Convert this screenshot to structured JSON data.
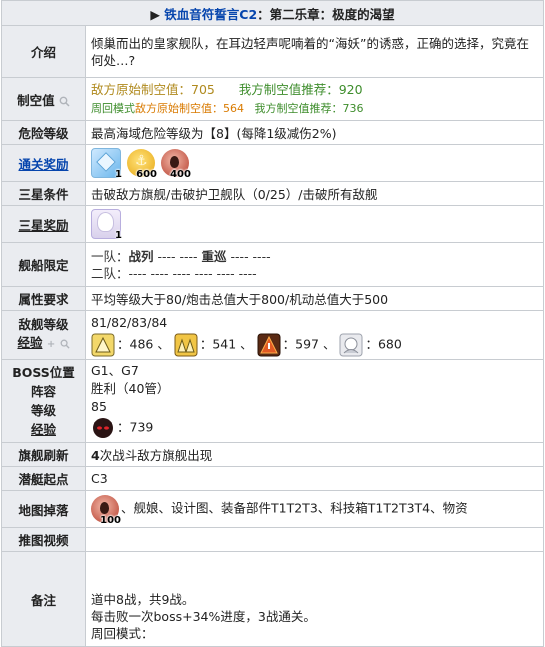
{
  "title": {
    "arrow": "▶ ",
    "link": "铁血音符誓言C2",
    "rest": "：第二乐章：极度的渴望"
  },
  "intro": {
    "label": "介绍",
    "text": "倾巢而出的皇家舰队，在耳边轻声呢喃着的“海妖”的诱惑，正确的选择，究竟在何处…?"
  },
  "air": {
    "label": "制空值",
    "line1_a": "敌方原始制空值：705",
    "line1_b": "我方制空值推荐：920",
    "line2_prefix": "周回模式",
    "line2_a": "敌方原始制空值：564",
    "line2_b": "我方制空值推荐：736"
  },
  "danger": {
    "label": "危险等级",
    "text": "最高海域危险等级为【8】(每降1级减伤2%)"
  },
  "clear_reward": {
    "label": "通关奖励",
    "items": [
      {
        "icon": "blue-cube-icon",
        "num": "1"
      },
      {
        "icon": "gold-coin-icon",
        "num": "600"
      },
      {
        "icon": "oil-icon",
        "num": "400"
      }
    ]
  },
  "three_star_cond": {
    "label": "三星条件",
    "text": "击破敌方旗舰/击破护卫舰队（0/25）/击破所有敌舰"
  },
  "three_star_reward": {
    "label": "三星奖励",
    "items": [
      {
        "icon": "character-icon",
        "num": "1"
      }
    ]
  },
  "ship_limit": {
    "label": "舰船限定",
    "fleet1_prefix": "一队：",
    "fleet1_a": "战列",
    "fleet1_mid": " ---- ---- ",
    "fleet1_b": "重巡",
    "fleet1_end": " ---- ----",
    "fleet2": "二队：---- ---- ---- ---- ---- ----"
  },
  "attr_req": {
    "label": "属性要求",
    "text": "平均等级大于80/炮击总值大于800/机动总值大于500"
  },
  "enemy_level": {
    "label1": "敌舰等级",
    "label2": "经验",
    "levels": "81/82/83/84",
    "exp": [
      {
        "icon": "small-enemy-icon",
        "value": "：486 、"
      },
      {
        "icon": "medium-enemy-icon",
        "value": "：541 、"
      },
      {
        "icon": "large-enemy-icon",
        "value": "：597 、"
      },
      {
        "icon": "elite-enemy-icon",
        "value": "：680"
      }
    ]
  },
  "boss": {
    "label_pos": "BOSS位置",
    "label_lineup": "阵容",
    "label_level": "等级",
    "label_exp": "经验",
    "pos": "G1、G7",
    "lineup": "胜利（40管）",
    "level": "85",
    "exp": "：739"
  },
  "flag_refresh": {
    "label": "旗舰刷新",
    "bold": "4",
    "text": "次战斗敌方旗舰出现"
  },
  "sub_start": {
    "label": "潜艇起点",
    "text": "C3"
  },
  "drops": {
    "label": "地图掉落",
    "num": "100",
    "text": "、舰娘、设计图、装备部件T1T2T3、科技箱T1T2T3T4、物资"
  },
  "video": {
    "label": "推图视频"
  },
  "notes": {
    "label": "备注",
    "lines": [
      "道中8战，共9战。",
      "每击败一次boss+34%进度，3战通关。",
      "周回模式："
    ]
  }
}
